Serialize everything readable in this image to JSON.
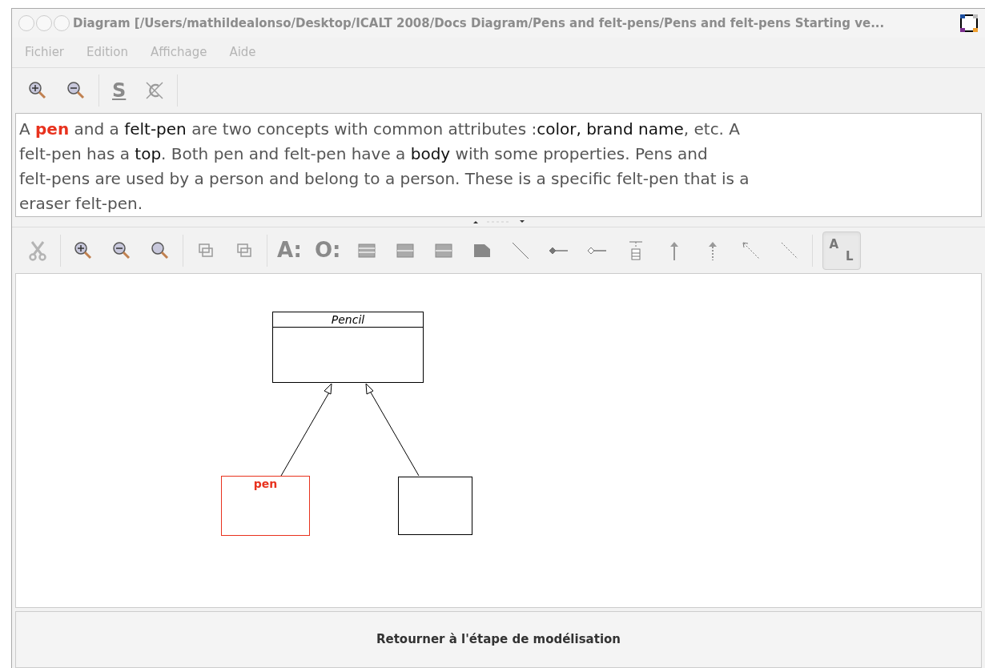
{
  "window": {
    "title": "Diagram [/Users/mathildealonso/Desktop/ICALT 2008/Docs Diagram/Pens and felt-pens/Pens and felt-pens Starting ve...",
    "active": false
  },
  "menu": [
    "Fichier",
    "Edition",
    "Affichage",
    "Aide"
  ],
  "top_toolbar": [
    {
      "kind": "zoom-in"
    },
    {
      "kind": "zoom-out"
    },
    {
      "kind": "sep"
    },
    {
      "kind": "underline",
      "label": "S"
    },
    {
      "kind": "clear"
    }
  ],
  "description": {
    "lines": [
      [
        {
          "text": "A ",
          "kind": "plain"
        },
        {
          "text": "pen",
          "kind": "focus"
        },
        {
          "text": " and a ",
          "kind": "plain"
        },
        {
          "text": "felt-pen",
          "kind": "key"
        },
        {
          "text": " are two concepts with common attributes :",
          "kind": "plain"
        },
        {
          "text": "color, brand name",
          "kind": "key"
        },
        {
          "text": ", etc. A",
          "kind": "plain"
        }
      ],
      [
        {
          "text": "felt-pen has a ",
          "kind": "plain"
        },
        {
          "text": "top",
          "kind": "key"
        },
        {
          "text": ". Both pen and felt-pen have a ",
          "kind": "plain"
        },
        {
          "text": "body",
          "kind": "key"
        },
        {
          "text": " with some properties. Pens and",
          "kind": "plain"
        }
      ],
      [
        {
          "text": "felt-pens are used by a person and belong to a person. These is a specific felt-pen that is a",
          "kind": "plain"
        }
      ],
      [
        {
          "text": "eraser felt-pen.",
          "kind": "plain"
        }
      ]
    ]
  },
  "diagram_toolbar": [
    {
      "kind": "cut",
      "disabled": true
    },
    {
      "kind": "sep"
    },
    {
      "kind": "zoom-in"
    },
    {
      "kind": "zoom-out"
    },
    {
      "kind": "zoom"
    },
    {
      "kind": "sep"
    },
    {
      "kind": "group"
    },
    {
      "kind": "ungroup"
    },
    {
      "kind": "sep"
    },
    {
      "kind": "text",
      "label": "A:"
    },
    {
      "kind": "text",
      "label": "O:"
    },
    {
      "kind": "list"
    },
    {
      "kind": "list2"
    },
    {
      "kind": "list2"
    },
    {
      "kind": "note"
    },
    {
      "kind": "line"
    },
    {
      "kind": "diamond-filled"
    },
    {
      "kind": "diamond-open"
    },
    {
      "kind": "composite"
    },
    {
      "kind": "arrow-solid"
    },
    {
      "kind": "arrow-dashed"
    },
    {
      "kind": "dashed-arrow"
    },
    {
      "kind": "dashed-line"
    },
    {
      "kind": "sep"
    },
    {
      "kind": "toggle",
      "label_top": "A",
      "label_bottom": "L",
      "selected": true
    }
  ],
  "classes": [
    {
      "name": "Pencil",
      "abstract": true,
      "highlighted": false
    },
    {
      "name": "pen",
      "abstract": false,
      "highlighted": true
    },
    {
      "abstract": false,
      "highlighted": false
    }
  ],
  "action_button": "Retourner à l'étape de modélisation"
}
